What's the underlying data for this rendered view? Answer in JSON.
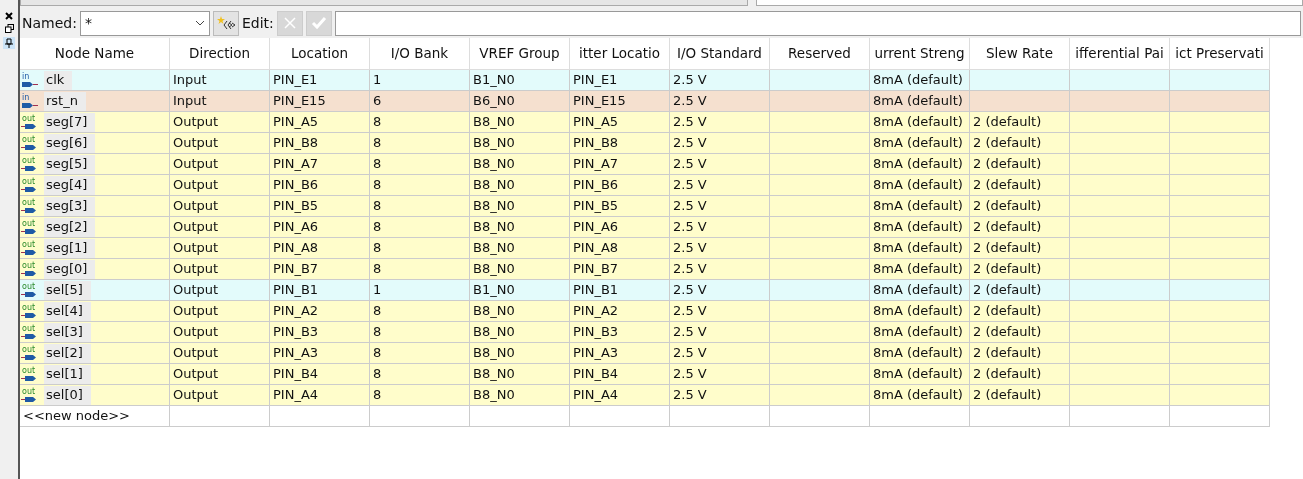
{
  "toolbar": {
    "named_label": "Named:",
    "named_value": "*",
    "edit_label": "Edit:",
    "cancel_disabled": true,
    "accept_disabled": true
  },
  "table": {
    "columns": [
      "Node Name",
      "Direction",
      "Location",
      "I/O Bank",
      "VREF Group",
      "itter Locatio",
      "I/O Standard",
      "Reserved",
      "urrent Streng",
      "Slew Rate",
      "ifferential Pai",
      "ict Preservati"
    ],
    "rows": [
      {
        "kind": "input",
        "pin_label": "in",
        "color": "#e3fbfb",
        "name": "clk",
        "direction": "Input",
        "location": "PIN_E1",
        "bank": "1",
        "vref": "B1_N0",
        "fitter": "PIN_E1",
        "standard": "2.5 V",
        "strength": "8mA (default)"
      },
      {
        "kind": "input",
        "pin_label": "in",
        "color": "#f5e0cf",
        "name": "rst_n",
        "direction": "Input",
        "location": "PIN_E15",
        "bank": "6",
        "vref": "B6_N0",
        "fitter": "PIN_E15",
        "standard": "2.5 V",
        "strength": "8mA (default)"
      },
      {
        "kind": "output",
        "pin_label": "out",
        "color": "#fffdcb",
        "name": "seg[7]",
        "direction": "Output",
        "location": "PIN_A5",
        "bank": "8",
        "vref": "B8_N0",
        "fitter": "PIN_A5",
        "standard": "2.5 V",
        "strength": "8mA (default)",
        "slew": "2 (default)"
      },
      {
        "kind": "output",
        "pin_label": "out",
        "color": "#fffdcb",
        "name": "seg[6]",
        "direction": "Output",
        "location": "PIN_B8",
        "bank": "8",
        "vref": "B8_N0",
        "fitter": "PIN_B8",
        "standard": "2.5 V",
        "strength": "8mA (default)",
        "slew": "2 (default)"
      },
      {
        "kind": "output",
        "pin_label": "out",
        "color": "#fffdcb",
        "name": "seg[5]",
        "direction": "Output",
        "location": "PIN_A7",
        "bank": "8",
        "vref": "B8_N0",
        "fitter": "PIN_A7",
        "standard": "2.5 V",
        "strength": "8mA (default)",
        "slew": "2 (default)"
      },
      {
        "kind": "output",
        "pin_label": "out",
        "color": "#fffdcb",
        "name": "seg[4]",
        "direction": "Output",
        "location": "PIN_B6",
        "bank": "8",
        "vref": "B8_N0",
        "fitter": "PIN_B6",
        "standard": "2.5 V",
        "strength": "8mA (default)",
        "slew": "2 (default)"
      },
      {
        "kind": "output",
        "pin_label": "out",
        "color": "#fffdcb",
        "name": "seg[3]",
        "direction": "Output",
        "location": "PIN_B5",
        "bank": "8",
        "vref": "B8_N0",
        "fitter": "PIN_B5",
        "standard": "2.5 V",
        "strength": "8mA (default)",
        "slew": "2 (default)"
      },
      {
        "kind": "output",
        "pin_label": "out",
        "color": "#fffdcb",
        "name": "seg[2]",
        "direction": "Output",
        "location": "PIN_A6",
        "bank": "8",
        "vref": "B8_N0",
        "fitter": "PIN_A6",
        "standard": "2.5 V",
        "strength": "8mA (default)",
        "slew": "2 (default)"
      },
      {
        "kind": "output",
        "pin_label": "out",
        "color": "#fffdcb",
        "name": "seg[1]",
        "direction": "Output",
        "location": "PIN_A8",
        "bank": "8",
        "vref": "B8_N0",
        "fitter": "PIN_A8",
        "standard": "2.5 V",
        "strength": "8mA (default)",
        "slew": "2 (default)"
      },
      {
        "kind": "output",
        "pin_label": "out",
        "color": "#fffdcb",
        "name": "seg[0]",
        "direction": "Output",
        "location": "PIN_B7",
        "bank": "8",
        "vref": "B8_N0",
        "fitter": "PIN_B7",
        "standard": "2.5 V",
        "strength": "8mA (default)",
        "slew": "2 (default)"
      },
      {
        "kind": "output",
        "pin_label": "out",
        "color": "#e3fbfb",
        "name": "sel[5]",
        "direction": "Output",
        "location": "PIN_B1",
        "bank": "1",
        "vref": "B1_N0",
        "fitter": "PIN_B1",
        "standard": "2.5 V",
        "strength": "8mA (default)",
        "slew": "2 (default)"
      },
      {
        "kind": "output",
        "pin_label": "out",
        "color": "#fffdcb",
        "name": "sel[4]",
        "direction": "Output",
        "location": "PIN_A2",
        "bank": "8",
        "vref": "B8_N0",
        "fitter": "PIN_A2",
        "standard": "2.5 V",
        "strength": "8mA (default)",
        "slew": "2 (default)"
      },
      {
        "kind": "output",
        "pin_label": "out",
        "color": "#fffdcb",
        "name": "sel[3]",
        "direction": "Output",
        "location": "PIN_B3",
        "bank": "8",
        "vref": "B8_N0",
        "fitter": "PIN_B3",
        "standard": "2.5 V",
        "strength": "8mA (default)",
        "slew": "2 (default)"
      },
      {
        "kind": "output",
        "pin_label": "out",
        "color": "#fffdcb",
        "name": "sel[2]",
        "direction": "Output",
        "location": "PIN_A3",
        "bank": "8",
        "vref": "B8_N0",
        "fitter": "PIN_A3",
        "standard": "2.5 V",
        "strength": "8mA (default)",
        "slew": "2 (default)"
      },
      {
        "kind": "output",
        "pin_label": "out",
        "color": "#fffdcb",
        "name": "sel[1]",
        "direction": "Output",
        "location": "PIN_B4",
        "bank": "8",
        "vref": "B8_N0",
        "fitter": "PIN_B4",
        "standard": "2.5 V",
        "strength": "8mA (default)",
        "slew": "2 (default)"
      },
      {
        "kind": "output",
        "pin_label": "out",
        "color": "#fffdcb",
        "name": "sel[0]",
        "direction": "Output",
        "location": "PIN_A4",
        "bank": "8",
        "vref": "B8_N0",
        "fitter": "PIN_A4",
        "standard": "2.5 V",
        "strength": "8mA (default)",
        "slew": "2 (default)"
      }
    ],
    "new_row": "<<new node>>"
  }
}
